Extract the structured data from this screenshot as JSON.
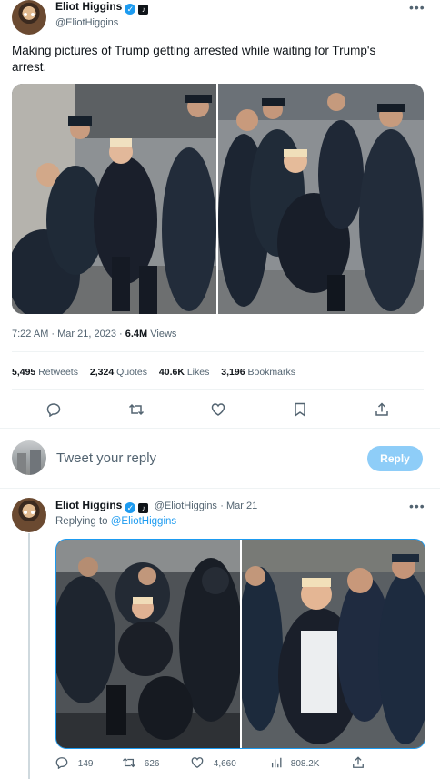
{
  "main_tweet": {
    "author_name": "Eliot Higgins",
    "author_handle": "@EliotHiggins",
    "text": "Making pictures of Trump getting arrested while waiting for Trump's arrest.",
    "time": "7:22 AM",
    "date": "Mar 21, 2023",
    "views_count": "6.4M",
    "views_label": "Views",
    "stats": [
      {
        "count": "5,495",
        "label": "Retweets"
      },
      {
        "count": "2,324",
        "label": "Quotes"
      },
      {
        "count": "40.6K",
        "label": "Likes"
      },
      {
        "count": "3,196",
        "label": "Bookmarks"
      }
    ],
    "actions": [
      "reply-icon",
      "retweet-icon",
      "like-icon",
      "bookmark-icon",
      "share-icon"
    ]
  },
  "reply_box": {
    "placeholder": "Tweet your reply",
    "button_label": "Reply"
  },
  "reply_tweet": {
    "author_name": "Eliot Higgins",
    "author_handle": "@EliotHiggins",
    "date": "· Mar 21",
    "replying_prefix": "Replying to",
    "replying_to": "@EliotHiggins",
    "actions": [
      {
        "icon": "reply-icon",
        "count": "149"
      },
      {
        "icon": "retweet-icon",
        "count": "626"
      },
      {
        "icon": "like-icon",
        "count": "4,660"
      },
      {
        "icon": "views-icon",
        "count": "808.2K"
      },
      {
        "icon": "share-icon",
        "count": ""
      }
    ]
  },
  "colors": {
    "accent": "#1d9bf0",
    "reply_button": "#8ecdf8",
    "text": "#0f1419",
    "secondary": "#536471"
  }
}
